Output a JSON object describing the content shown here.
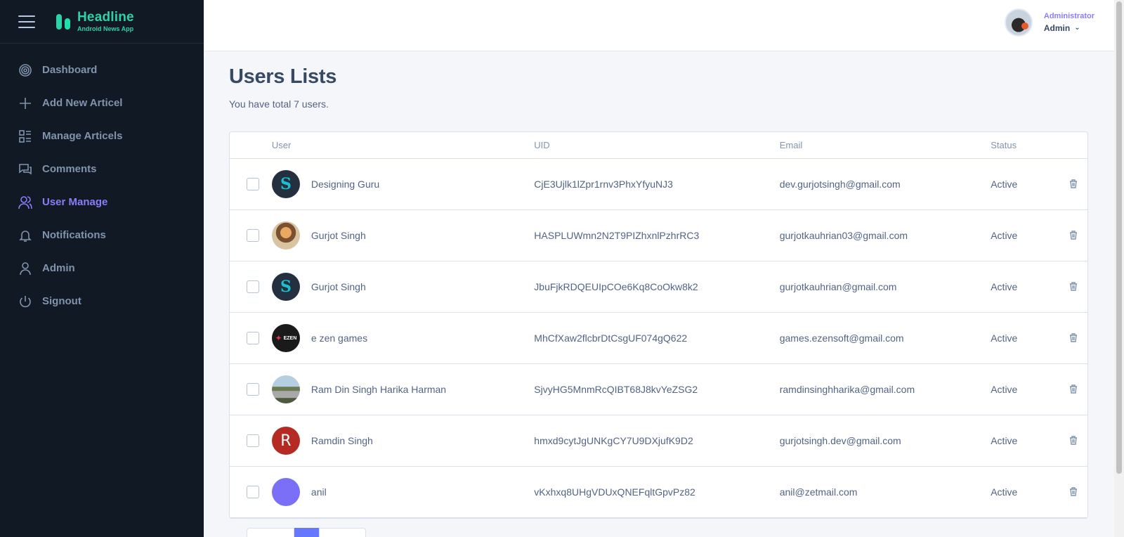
{
  "brand": {
    "title": "Headline",
    "subtitle": "Android News App"
  },
  "sidebar": {
    "items": [
      {
        "label": "Dashboard",
        "icon": "dashboard-icon"
      },
      {
        "label": "Add New Articel",
        "icon": "plus-icon"
      },
      {
        "label": "Manage Articels",
        "icon": "grid-list-icon"
      },
      {
        "label": "Comments",
        "icon": "comments-icon"
      },
      {
        "label": "User Manage",
        "icon": "users-icon",
        "active": true
      },
      {
        "label": "Notifications",
        "icon": "bell-icon"
      },
      {
        "label": "Admin",
        "icon": "user-icon"
      },
      {
        "label": "Signout",
        "icon": "power-icon"
      }
    ]
  },
  "header": {
    "role": "Administrator",
    "name": "Admin"
  },
  "main": {
    "title": "Users Lists",
    "subtitle": "You have total 7 users.",
    "table": {
      "columns": {
        "user": "User",
        "uid": "UID",
        "email": "Email",
        "status": "Status"
      },
      "rows": [
        {
          "name": "Designing Guru",
          "uid": "CjE3Ujlk1lZpr1rnv3PhxYfyuNJ3",
          "email": "dev.gurjotsingh@gmail.com",
          "status": "Active",
          "avatar": "logo-s"
        },
        {
          "name": "Gurjot Singh",
          "uid": "HASPLUWmn2N2T9PIZhxnlPzhrRC3",
          "email": "gurjotkauhrian03@gmail.com",
          "status": "Active",
          "avatar": "photo"
        },
        {
          "name": "Gurjot Singh",
          "uid": "JbuFjkRDQEUIpCOe6Kq8CoOkw8k2",
          "email": "gurjotkauhrian@gmail.com",
          "status": "Active",
          "avatar": "logo-s"
        },
        {
          "name": "e zen games",
          "uid": "MhCfXaw2flcbrDtCsgUF074gQ622",
          "email": "games.ezensoft@gmail.com",
          "status": "Active",
          "avatar": "ezen-logo",
          "avatar_text": "EZEN"
        },
        {
          "name": "Ram Din Singh Harika Harman",
          "uid": "SjvyHG5MnmRcQIBT68J8kvYeZSG2",
          "email": "ramdinsinghharika@gmail.com",
          "status": "Active",
          "avatar": "photo"
        },
        {
          "name": "Ramdin Singh",
          "uid": "hmxd9cytJgUNKgCY7U9DXjufK9D2",
          "email": "gurjotsingh.dev@gmail.com",
          "status": "Active",
          "avatar": "initial",
          "avatar_text": "R"
        },
        {
          "name": "anil",
          "uid": "vKxhxq8UHgVDUxQNEFqltGpvPz82",
          "email": "anil@zetmail.com",
          "status": "Active",
          "avatar": "blank"
        }
      ]
    }
  },
  "colors": {
    "sidebar_bg": "#101924",
    "accent": "#8b7cf8",
    "brand": "#2fd1a7",
    "pager_active": "#6576ff"
  }
}
